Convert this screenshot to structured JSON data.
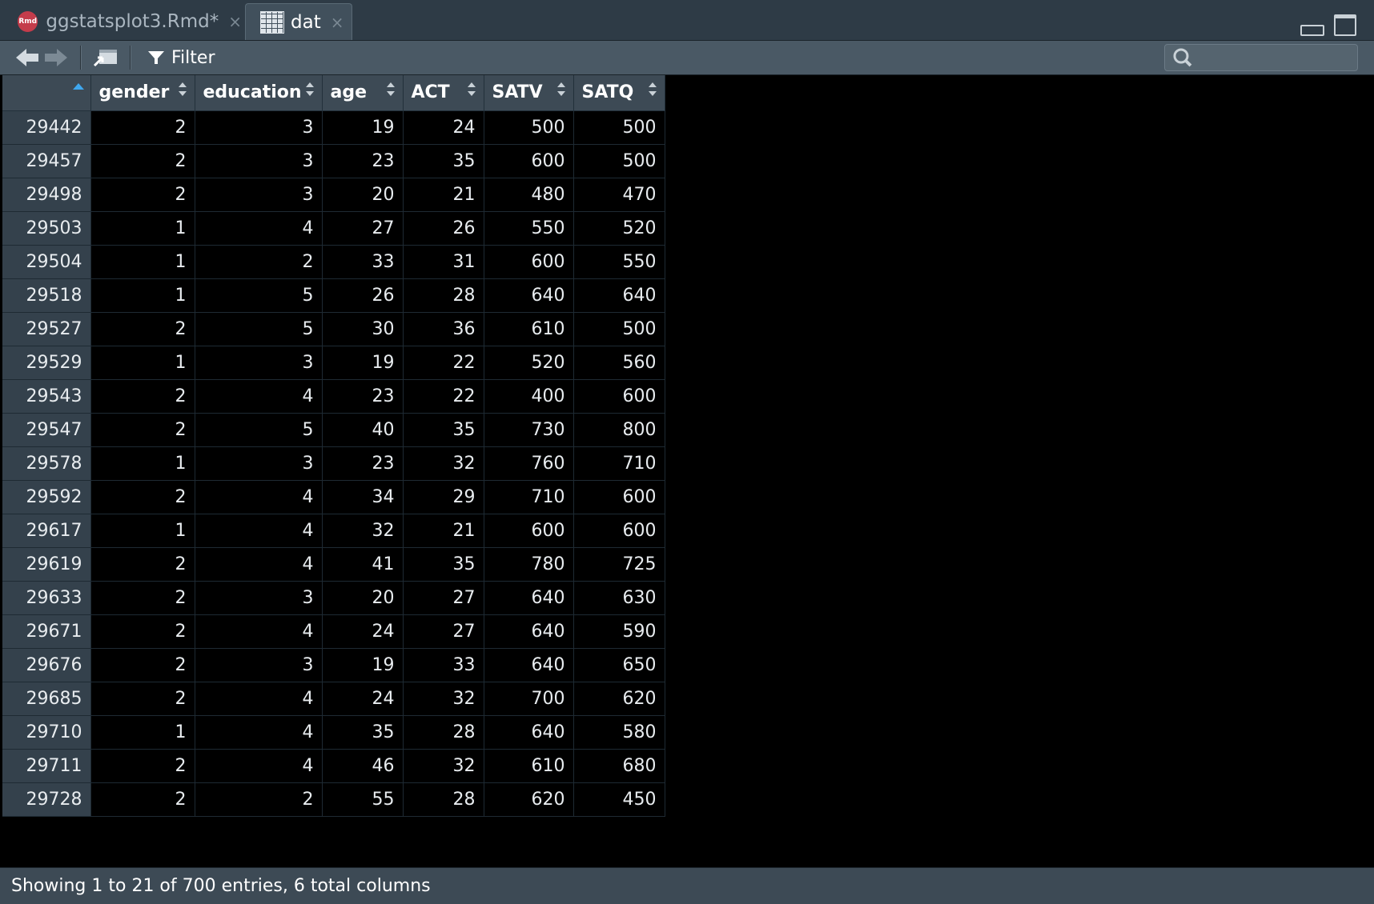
{
  "tabs": [
    {
      "label": "ggstatsplot3.Rmd*",
      "icon": "rmd-file-icon",
      "close": "×"
    },
    {
      "label": "dat",
      "icon": "data-grid-icon",
      "close": "×"
    }
  ],
  "toolbar": {
    "filter_label": "Filter",
    "search_placeholder": ""
  },
  "table": {
    "columns": [
      "gender",
      "education",
      "age",
      "ACT",
      "SATV",
      "SATQ"
    ],
    "rows": [
      [
        "29442",
        "2",
        "3",
        "19",
        "24",
        "500",
        "500"
      ],
      [
        "29457",
        "2",
        "3",
        "23",
        "35",
        "600",
        "500"
      ],
      [
        "29498",
        "2",
        "3",
        "20",
        "21",
        "480",
        "470"
      ],
      [
        "29503",
        "1",
        "4",
        "27",
        "26",
        "550",
        "520"
      ],
      [
        "29504",
        "1",
        "2",
        "33",
        "31",
        "600",
        "550"
      ],
      [
        "29518",
        "1",
        "5",
        "26",
        "28",
        "640",
        "640"
      ],
      [
        "29527",
        "2",
        "5",
        "30",
        "36",
        "610",
        "500"
      ],
      [
        "29529",
        "1",
        "3",
        "19",
        "22",
        "520",
        "560"
      ],
      [
        "29543",
        "2",
        "4",
        "23",
        "22",
        "400",
        "600"
      ],
      [
        "29547",
        "2",
        "5",
        "40",
        "35",
        "730",
        "800"
      ],
      [
        "29578",
        "1",
        "3",
        "23",
        "32",
        "760",
        "710"
      ],
      [
        "29592",
        "2",
        "4",
        "34",
        "29",
        "710",
        "600"
      ],
      [
        "29617",
        "1",
        "4",
        "32",
        "21",
        "600",
        "600"
      ],
      [
        "29619",
        "2",
        "4",
        "41",
        "35",
        "780",
        "725"
      ],
      [
        "29633",
        "2",
        "3",
        "20",
        "27",
        "640",
        "630"
      ],
      [
        "29671",
        "2",
        "4",
        "24",
        "27",
        "640",
        "590"
      ],
      [
        "29676",
        "2",
        "3",
        "19",
        "33",
        "640",
        "650"
      ],
      [
        "29685",
        "2",
        "4",
        "24",
        "32",
        "700",
        "620"
      ],
      [
        "29710",
        "1",
        "4",
        "35",
        "28",
        "640",
        "580"
      ],
      [
        "29711",
        "2",
        "4",
        "46",
        "32",
        "610",
        "680"
      ],
      [
        "29728",
        "2",
        "2",
        "55",
        "28",
        "620",
        "450"
      ]
    ]
  },
  "status": "Showing 1 to 21 of 700 entries, 6 total columns",
  "colors": {
    "tabbar_bg": "#2e3b46",
    "toolbar_bg": "#4a5965",
    "header_bg": "#3d4a55",
    "sort_accent": "#3fa7ee",
    "cell_bg": "#000000"
  }
}
